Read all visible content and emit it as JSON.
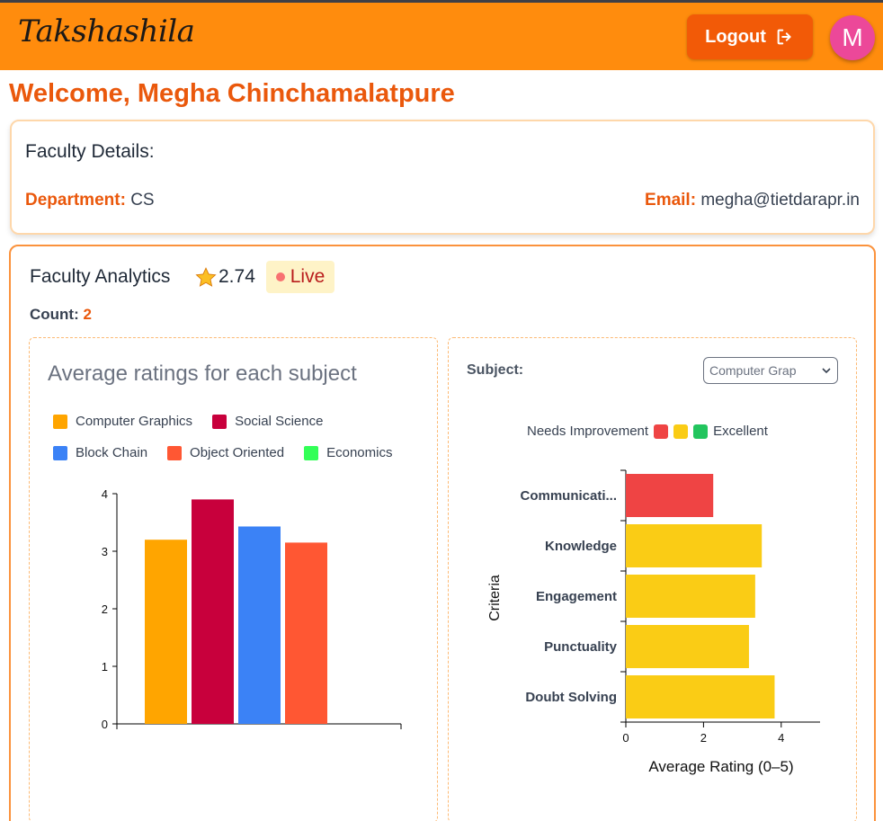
{
  "app": {
    "brand": "Takshashila",
    "logout_label": "Logout",
    "avatar_initial": "M"
  },
  "welcome": "Welcome, Megha Chinchamalatpure",
  "details": {
    "title": "Faculty Details:",
    "department_label": "Department:",
    "department_value": "CS",
    "email_label": "Email:",
    "email_value": "megha@tietdarapr.in"
  },
  "analytics": {
    "title": "Faculty Analytics",
    "rating": "2.74",
    "live_label": "Live",
    "count_label": "Count:",
    "count_value": "2"
  },
  "subject_panel": {
    "label": "Subject:",
    "selected": "Computer Grap",
    "scale_low": "Needs Improvement",
    "scale_high": "Excellent",
    "scale_colors": [
      "#ef4444",
      "#facc15",
      "#22c55e"
    ]
  },
  "chart_data": [
    {
      "type": "bar",
      "title": "Average ratings for each subject",
      "categories": [
        "Computer Graphics",
        "Social Science",
        "Block Chain",
        "Object Oriented",
        "Economics"
      ],
      "values": [
        3.2,
        3.9,
        3.43,
        3.15,
        null
      ],
      "colors": [
        "#ffa500",
        "#c8003c",
        "#3b82f6",
        "#ff5733",
        "#33ff57"
      ],
      "ylim": [
        0,
        4
      ],
      "yticks": [
        "0",
        "1",
        "2",
        "3",
        "4"
      ],
      "legend": "top"
    },
    {
      "type": "bar",
      "orientation": "horizontal",
      "categories": [
        "Communicati...",
        "Knowledge",
        "Engagement",
        "Punctuality",
        "Doubt Solving"
      ],
      "values": [
        2.25,
        3.5,
        3.33,
        3.17,
        3.83
      ],
      "colors": [
        "#ef4444",
        "#facc15",
        "#facc15",
        "#facc15",
        "#facc15"
      ],
      "xlabel": "Average Rating (0–5)",
      "ylabel": "Criteria",
      "xlim": [
        0,
        5
      ],
      "xticks": [
        "0",
        "2",
        "4"
      ]
    }
  ],
  "colors": {
    "header": "#ff8c0d",
    "accent": "#ea580c",
    "avatar": "#ec4899"
  }
}
